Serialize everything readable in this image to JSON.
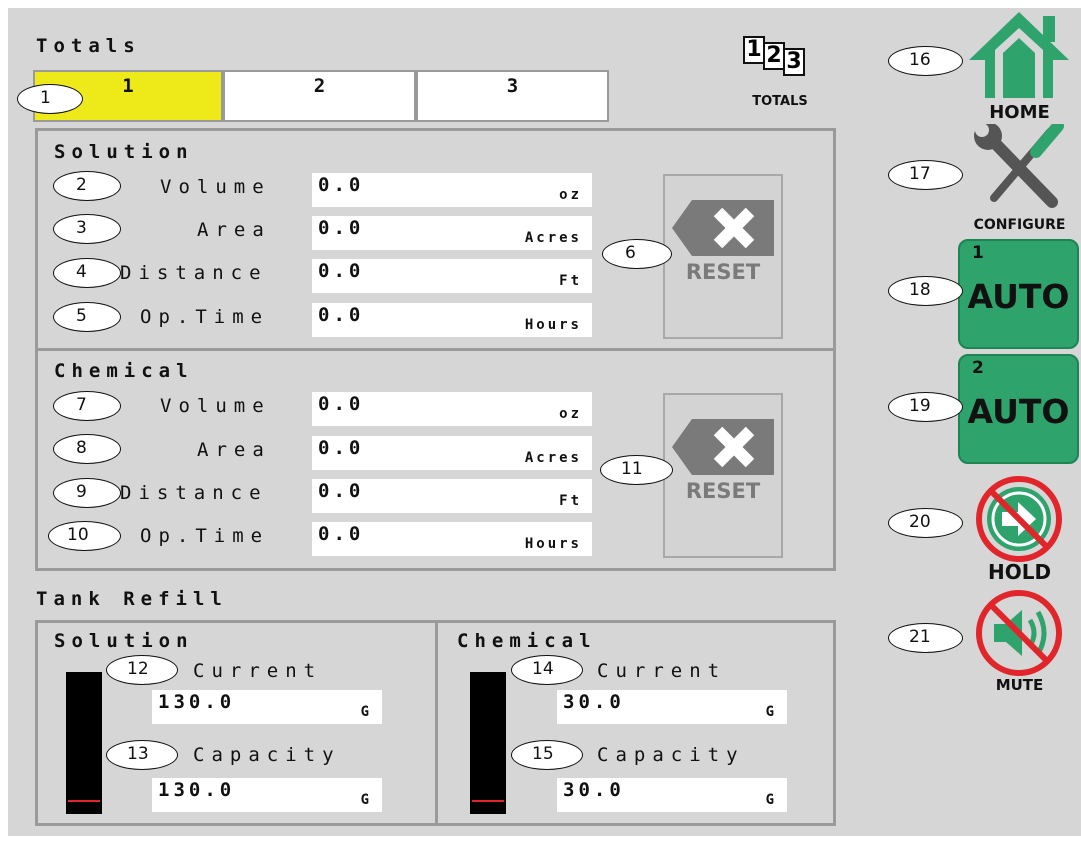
{
  "header": {
    "title": "Totals",
    "totals_icon_label": "TOTALS",
    "totals_icon_digits": [
      "1",
      "2",
      "3"
    ]
  },
  "tabs": [
    {
      "label": "1"
    },
    {
      "label": "2"
    },
    {
      "label": "3"
    }
  ],
  "solution": {
    "title": "Solution",
    "rows": [
      {
        "label": "Volume",
        "value": "0.0",
        "unit": "oz"
      },
      {
        "label": "Area",
        "value": "0.0",
        "unit": "Acres"
      },
      {
        "label": "Distance",
        "value": "0.0",
        "unit": "Ft"
      },
      {
        "label": "Op.Time",
        "value": "0.0",
        "unit": "Hours"
      }
    ],
    "reset_label": "RESET"
  },
  "chemical": {
    "title": "Chemical",
    "rows": [
      {
        "label": "Volume",
        "value": "0.0",
        "unit": "oz"
      },
      {
        "label": "Area",
        "value": "0.0",
        "unit": "Acres"
      },
      {
        "label": "Distance",
        "value": "0.0",
        "unit": "Ft"
      },
      {
        "label": "Op.Time",
        "value": "0.0",
        "unit": "Hours"
      }
    ],
    "reset_label": "RESET"
  },
  "tank_refill": {
    "title": "Tank Refill",
    "solution": {
      "title": "Solution",
      "current_label": "Current",
      "current_value": "130.0",
      "current_unit": "G",
      "capacity_label": "Capacity",
      "capacity_value": "130.0",
      "capacity_unit": "G",
      "fill_fraction": 0.0
    },
    "chemical": {
      "title": "Chemical",
      "current_label": "Current",
      "current_value": "30.0",
      "current_unit": "G",
      "capacity_label": "Capacity",
      "capacity_value": "30.0",
      "capacity_unit": "G",
      "fill_fraction": 0.0
    }
  },
  "sidebar": {
    "home_label": "HOME",
    "configure_label": "CONFIGURE",
    "auto1": {
      "num": "1",
      "label": "AUTO"
    },
    "auto2": {
      "num": "2",
      "label": "AUTO"
    },
    "hold_label": "HOLD",
    "mute_label": "MUTE"
  },
  "callouts": [
    "1",
    "2",
    "3",
    "4",
    "5",
    "6",
    "7",
    "8",
    "9",
    "10",
    "11",
    "12",
    "13",
    "14",
    "15",
    "16",
    "17",
    "18",
    "19",
    "20",
    "21"
  ],
  "colors": {
    "background": "#d6d6d6",
    "active_tab": "#eeea1a",
    "auto_green": "#2ea36b",
    "icon_green": "#2ea36b",
    "reset_gray": "#7a7a7a",
    "no_symbol_red": "#e0262b"
  }
}
